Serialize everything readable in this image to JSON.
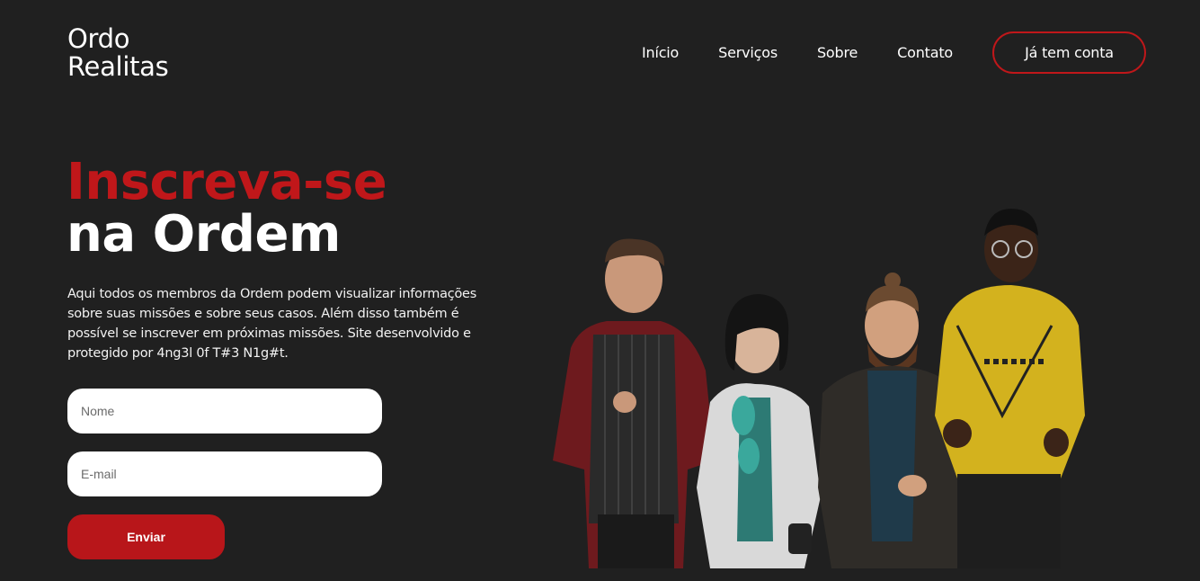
{
  "logo": {
    "line1": "Ordo",
    "line2": "Realitas"
  },
  "nav": {
    "items": [
      "Início",
      "Serviços",
      "Sobre",
      "Contato"
    ],
    "account_button": "Já tem conta"
  },
  "hero": {
    "title_red": "Inscreva-se",
    "title_white": "na Ordem",
    "description": "Aqui todos os membros da Ordem podem visualizar informações sobre suas missões e sobre seus casos. Além disso também é possível se inscrever em próximas missões. Site desenvolvido e protegido por 4ng3l 0f T#3 N1g#t."
  },
  "form": {
    "name_placeholder": "Nome",
    "email_placeholder": "E-mail",
    "submit_label": "Enviar"
  },
  "colors": {
    "background": "#202020",
    "accent": "#c0171a",
    "button": "#b8161a"
  }
}
